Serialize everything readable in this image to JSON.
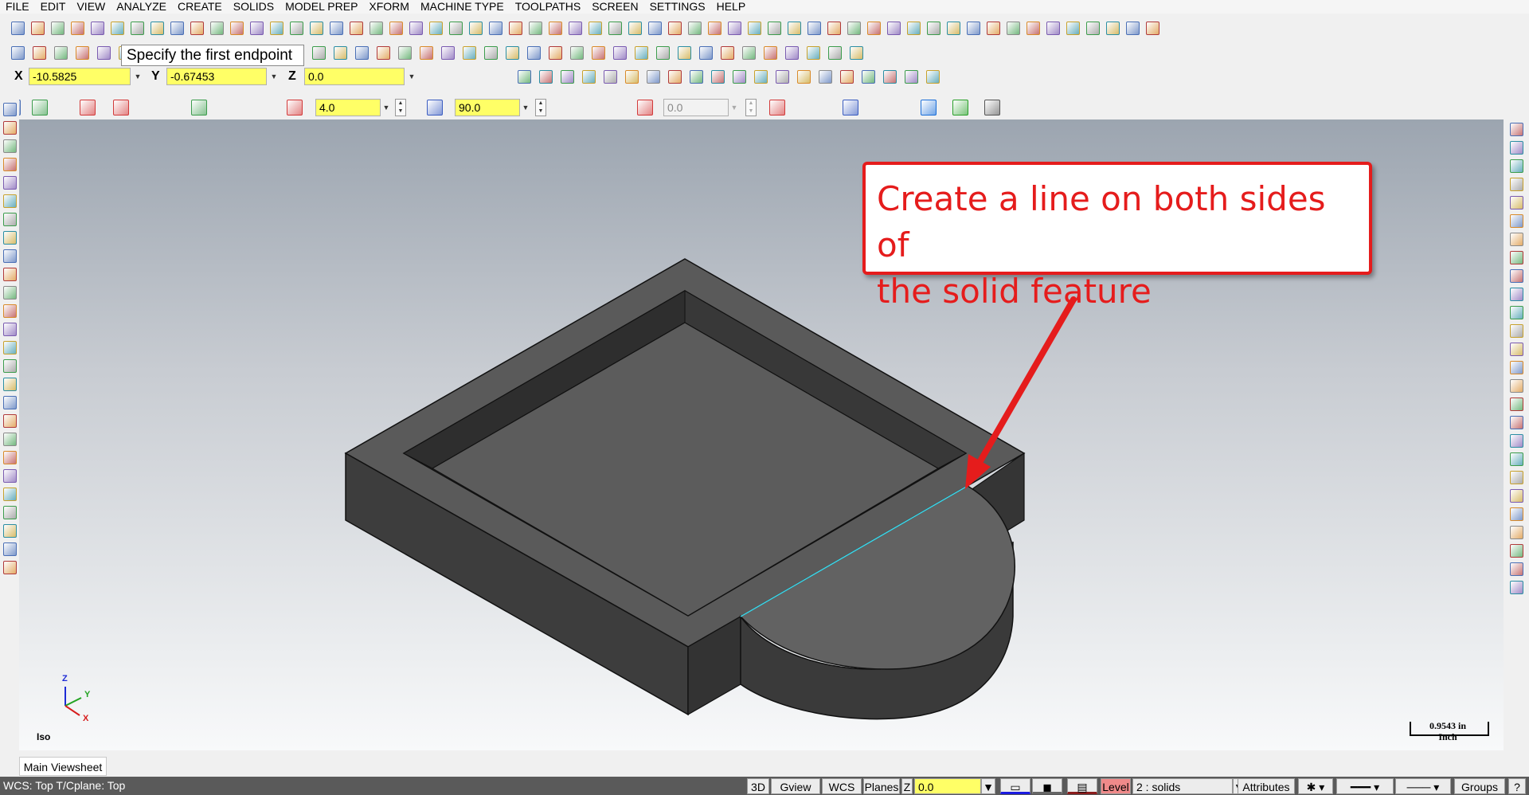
{
  "menu": [
    "FILE",
    "EDIT",
    "VIEW",
    "ANALYZE",
    "CREATE",
    "SOLIDS",
    "MODEL PREP",
    "XFORM",
    "MACHINE TYPE",
    "TOOLPATHS",
    "SCREEN",
    "SETTINGS",
    "HELP"
  ],
  "tooltip": "Specify the first endpoint",
  "coords": {
    "x_label": "X",
    "x_value": "-10.5825",
    "y_label": "Y",
    "y_value": "-0.67453",
    "z_label": "Z",
    "z_value": "0.0"
  },
  "ribbon": {
    "length_value": "4.0",
    "angle_value": "90.0",
    "offset_value": "0.0"
  },
  "callout": {
    "line1": "Create a line on both sides of",
    "line2": "the solid feature"
  },
  "view": {
    "name": "Iso",
    "axis_x": "X",
    "axis_y": "Y",
    "axis_z": "Z",
    "scale_value": "0.9543 in",
    "scale_unit": "Inch"
  },
  "viewsheet_tab": "Main Viewsheet",
  "status": {
    "wcs_text": "WCS: Top  T/Cplane: Top",
    "btn_3d": "3D",
    "btn_gview": "Gview",
    "btn_wcs": "WCS",
    "btn_planes": "Planes",
    "z_label": "Z",
    "z_value": "0.0",
    "level_label": "Level",
    "level_value": "2 : solids",
    "attributes": "Attributes",
    "groups": "Groups",
    "help": "?"
  },
  "colors": {
    "accent_red": "#e51c1c",
    "field_yellow": "#ffff66",
    "solid_top": "#5a5a5a",
    "solid_side": "#3b3b3b",
    "highlight_line": "#3fd6e8"
  }
}
